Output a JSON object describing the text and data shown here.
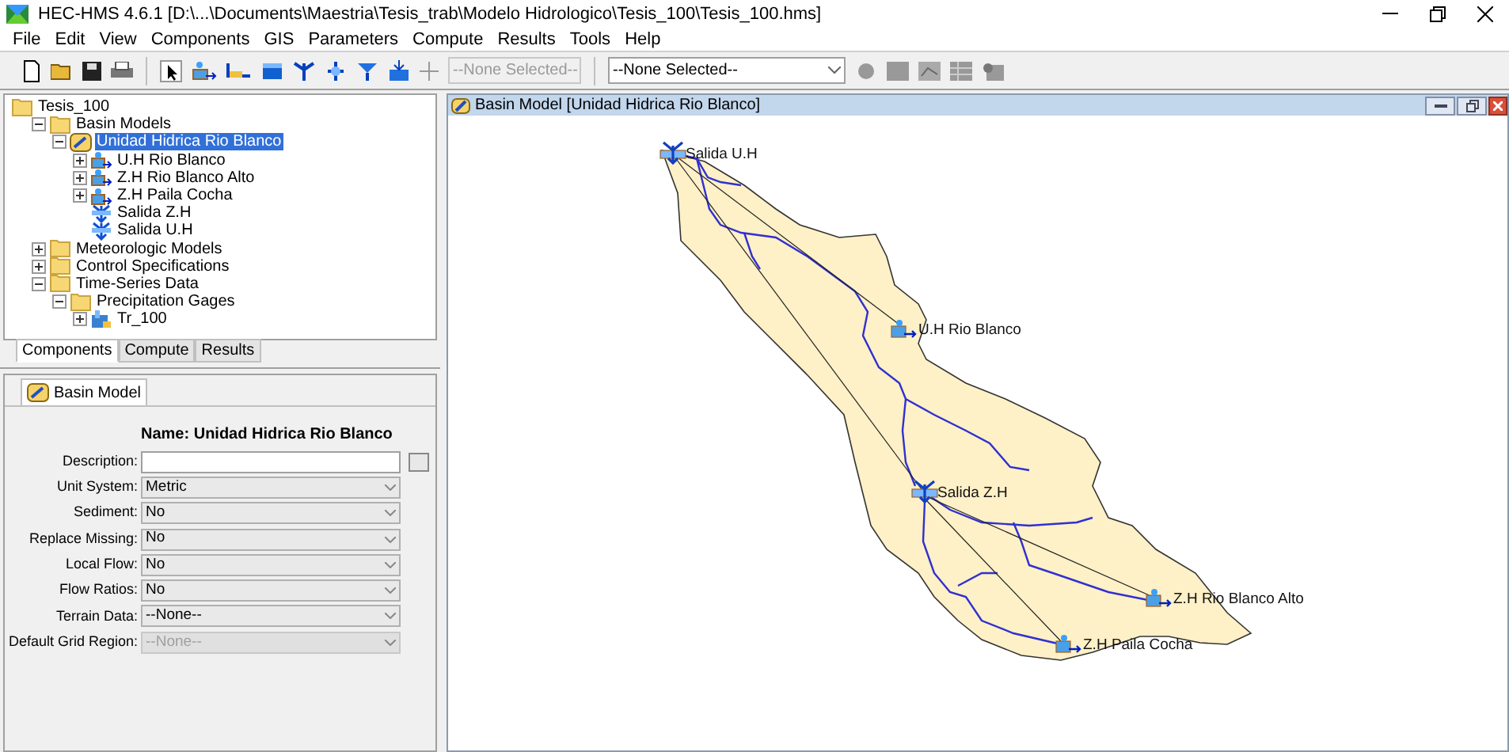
{
  "window": {
    "title": "HEC-HMS 4.6.1 [D:\\...\\Documents\\Maestria\\Tesis_trab\\Modelo Hidrologico\\Tesis_100\\Tesis_100.hms]"
  },
  "menu": [
    "File",
    "Edit",
    "View",
    "Components",
    "GIS",
    "Parameters",
    "Compute",
    "Results",
    "Tools",
    "Help"
  ],
  "toolbar": {
    "element_dropdown": {
      "value": "--None Selected--",
      "disabled": true
    },
    "run_dropdown": {
      "value": "--None Selected--",
      "disabled": false
    }
  },
  "tree": [
    {
      "label": "Tesis_100",
      "kind": "folder",
      "selected": false,
      "children": [
        {
          "label": "Basin Models",
          "kind": "folder",
          "selected": false,
          "expanded": true,
          "children": [
            {
              "label": "Unidad Hidrica Rio Blanco",
              "kind": "basin",
              "selected": true,
              "expanded": true,
              "children": [
                {
                  "label": "U.H Rio Blanco",
                  "kind": "subbasin",
                  "selected": false,
                  "expanded": false
                },
                {
                  "label": "Z.H Rio Blanco Alto",
                  "kind": "subbasin",
                  "selected": false,
                  "expanded": false
                },
                {
                  "label": "Z.H Paila Cocha",
                  "kind": "subbasin",
                  "selected": false,
                  "expanded": false
                },
                {
                  "label": "Salida Z.H",
                  "kind": "junction",
                  "selected": false
                },
                {
                  "label": "Salida U.H",
                  "kind": "junction",
                  "selected": false
                }
              ]
            }
          ]
        },
        {
          "label": "Meteorologic Models",
          "kind": "folder",
          "selected": false,
          "expanded": false
        },
        {
          "label": "Control Specifications",
          "kind": "folder",
          "selected": false,
          "expanded": false
        },
        {
          "label": "Time-Series Data",
          "kind": "folder",
          "selected": false,
          "expanded": true,
          "children": [
            {
              "label": "Precipitation Gages",
              "kind": "folder",
              "selected": false,
              "expanded": true,
              "children": [
                {
                  "label": "Tr_100",
                  "kind": "gage",
                  "selected": false,
                  "expanded": false
                }
              ]
            }
          ]
        }
      ]
    }
  ],
  "explorer_tabs": [
    {
      "label": "Components",
      "selected": true
    },
    {
      "label": "Compute",
      "selected": false
    },
    {
      "label": "Results",
      "selected": false
    }
  ],
  "properties": {
    "tab": "Basin Model",
    "name": "Name: Unidad Hidrica Rio Blanco",
    "fields": [
      {
        "label": "Description:",
        "kind": "text"
      },
      {
        "label": "Unit System:",
        "kind": "select",
        "value": "Metric",
        "disabled": false
      },
      {
        "label": "Sediment:",
        "kind": "select",
        "value": "No",
        "disabled": false
      },
      {
        "label": "Replace Missing:",
        "kind": "select",
        "value": "No",
        "disabled": false
      },
      {
        "label": "Local Flow:",
        "kind": "select",
        "value": "No",
        "disabled": false
      },
      {
        "label": "Flow Ratios:",
        "kind": "select",
        "value": "No",
        "disabled": false
      },
      {
        "label": "Terrain Data:",
        "kind": "select",
        "value": "--None--",
        "disabled": false
      },
      {
        "label": "Default Grid Region:",
        "kind": "select",
        "value": "--None--",
        "disabled": true
      }
    ]
  },
  "basin_window": {
    "title": "Basin Model [Unidad Hidrica Rio Blanco]",
    "nodes": [
      {
        "label": "Salida U.H",
        "kind": "junction"
      },
      {
        "label": "U.H Rio Blanco",
        "kind": "subbasin"
      },
      {
        "label": "Salida Z.H",
        "kind": "junction"
      },
      {
        "label": "Z.H Rio Blanco Alto",
        "kind": "subbasin"
      },
      {
        "label": "Z.H Paila Cocha",
        "kind": "subbasin"
      }
    ]
  }
}
